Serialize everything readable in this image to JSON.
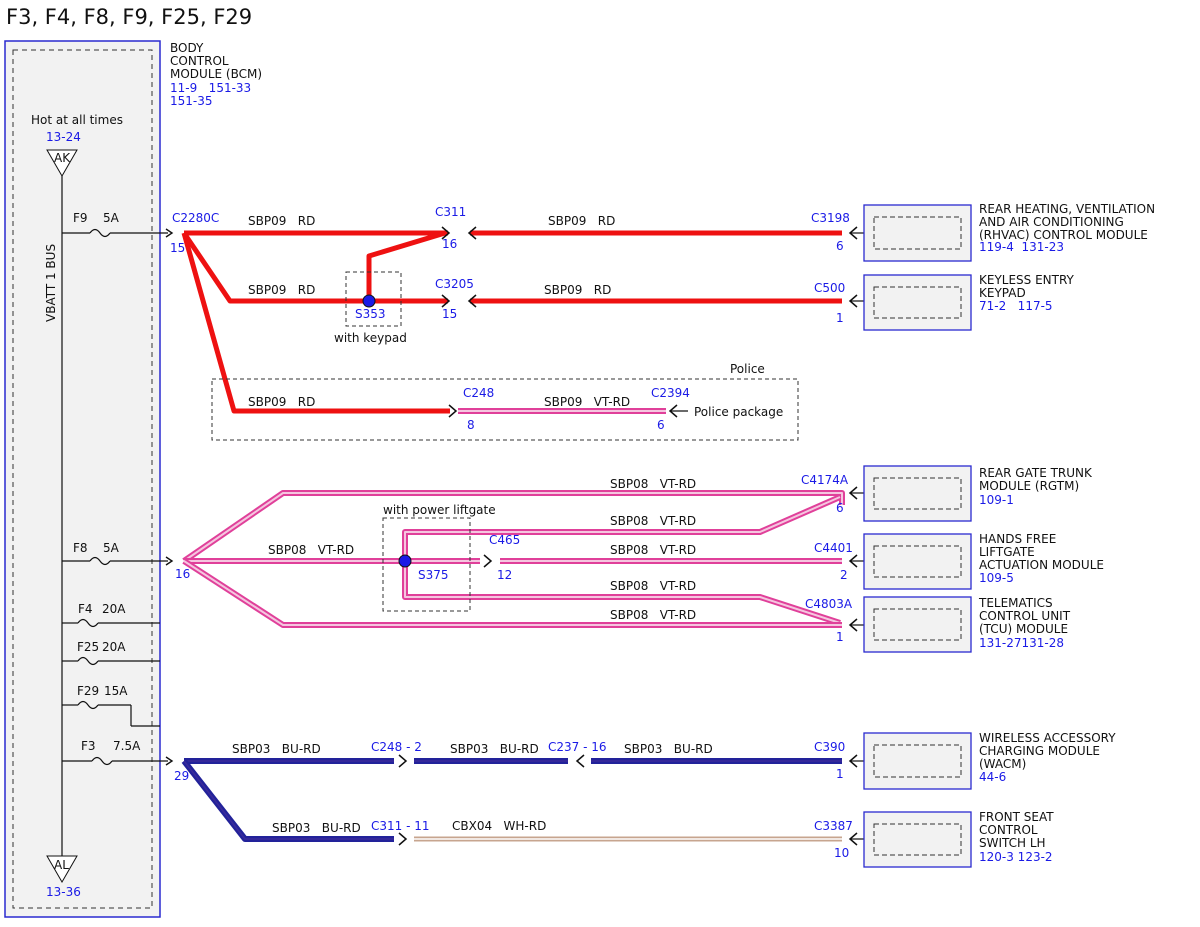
{
  "title": "F3, F4, F8, F9, F25, F29",
  "colors": {
    "red": "#ee1111",
    "red_dark": "#cc0000",
    "pink": "#e0409a",
    "pink_light": "#f5c6df",
    "blue": "#1a1ae6",
    "navy": "#22229a",
    "purple": "#3b2b9a",
    "tan": "#c7a58f",
    "panel": "#f2f2f2"
  },
  "bcm": {
    "name_lines": [
      "BODY",
      "CONTROL",
      "MODULE (BCM)"
    ],
    "refs_lines": [
      "11-9   151-33",
      "151-35"
    ]
  },
  "bus": {
    "hot_label": "Hot at all times",
    "top_ref": "13-24",
    "top_term": "AK",
    "bus_label": "VBATT 1 BUS",
    "bottom_term": "AL",
    "bottom_ref": "13-36"
  },
  "fuses": [
    {
      "id": "F9",
      "rating": "5A"
    },
    {
      "id": "F8",
      "rating": "5A"
    },
    {
      "id": "F4",
      "rating": "20A"
    },
    {
      "id": "F25",
      "rating": "20A"
    },
    {
      "id": "F29",
      "rating": "15A"
    },
    {
      "id": "F3",
      "rating": "7.5A"
    }
  ],
  "connectors": {
    "c2280c": "C2280C",
    "c2280c_pin15": "15",
    "c2280c_pin16": "16",
    "c2280c_pin29": "29",
    "c311": "C311",
    "c311_pin": "16",
    "c3198": "C3198",
    "c3198_pin": "6",
    "c3205": "C3205",
    "c3205_pin": "15",
    "c500": "C500",
    "c500_pin": "1",
    "s353": "S353",
    "c248": "C248",
    "c248_pin": "8",
    "c2394": "C2394",
    "c2394_pin": "6",
    "c4174a": "C4174A",
    "c4174a_pin": "6",
    "c465": "C465",
    "c465_pin": "12",
    "s375": "S375",
    "c4401": "C4401",
    "c4401_pin": "2",
    "c4803a": "C4803A",
    "c4803a_pin": "1",
    "c248_2": "C248 - 2",
    "c237_16": "C237 - 16",
    "c390": "C390",
    "c390_pin": "1",
    "c311_11": "C311 - 11",
    "c3387": "C3387",
    "c3387_pin": "10"
  },
  "circuits": {
    "sbp09_rd_1": "SBP09   RD",
    "sbp09_rd_2": "SBP09   RD",
    "sbp09_rd_3": "SBP09   RD",
    "sbp09_rd_4": "SBP09   RD",
    "sbp09_rd_5": "SBP09   RD",
    "sbp09_vtrd": "SBP09   VT-RD",
    "sbp08_1": "SBP08   VT-RD",
    "sbp08_2": "SBP08   VT-RD",
    "sbp08_3": "SBP08   VT-RD",
    "sbp08_4": "SBP08   VT-RD",
    "sbp08_5": "SBP08   VT-RD",
    "sbp08_6": "SBP08   VT-RD",
    "sbp03_1": "SBP03   BU-RD",
    "sbp03_2": "SBP03   BU-RD",
    "sbp03_3": "SBP03   BU-RD",
    "sbp03_4": "SBP03   BU-RD",
    "cbx04": "CBX04   WH-RD"
  },
  "notes": {
    "with_keypad": "with keypad",
    "police": "Police",
    "police_package": "Police package",
    "with_power_liftgate": "with power liftgate"
  },
  "modules": [
    {
      "lines": [
        "REAR HEATING, VENTILATION",
        "AND AIR CONDITIONING",
        "(RHVAC) CONTROL MODULE"
      ],
      "refs": "119-4  131-23"
    },
    {
      "lines": [
        "KEYLESS ENTRY",
        "KEYPAD"
      ],
      "refs": "71-2   117-5"
    },
    {
      "lines": [
        "REAR GATE TRUNK",
        "MODULE (RGTM)"
      ],
      "refs": "109-1"
    },
    {
      "lines": [
        "HANDS FREE",
        "LIFTGATE",
        "ACTUATION MODULE"
      ],
      "refs": "109-5"
    },
    {
      "lines": [
        "TELEMATICS",
        "CONTROL UNIT",
        "(TCU) MODULE"
      ],
      "refs": "131-27131-28"
    },
    {
      "lines": [
        "WIRELESS ACCESSORY",
        "CHARGING MODULE",
        "(WACM)"
      ],
      "refs": "44-6"
    },
    {
      "lines": [
        "FRONT SEAT",
        "CONTROL",
        "SWITCH LH"
      ],
      "refs": "120-3 123-2"
    }
  ]
}
